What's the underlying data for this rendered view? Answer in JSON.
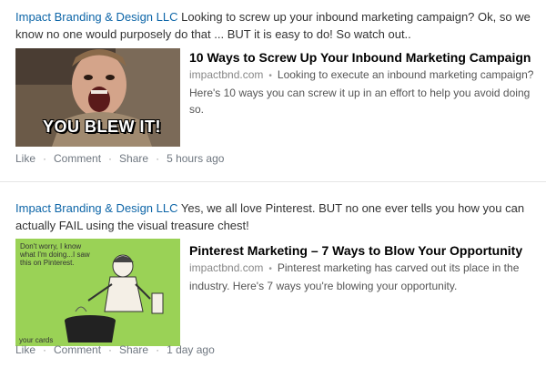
{
  "posts": [
    {
      "author": "Impact Branding & Design LLC",
      "text": " Looking to screw up your inbound marketing campaign? Ok, so we know no one would purposely do that ... BUT it is easy to do! So watch out..",
      "thumbnail_caption": "YOU BLEW IT!",
      "article_title": "10 Ways to Screw Up Your Inbound Marketing Campaign",
      "article_source": "impactbnd.com",
      "article_desc": "Looking to execute an inbound marketing campaign? Here's 10 ways you can screw it up in an effort to help you avoid doing so.",
      "like": "Like",
      "comment": "Comment",
      "share": "Share",
      "time": "5 hours ago"
    },
    {
      "author": "Impact Branding & Design LLC",
      "text": " Yes, we all love Pinterest. BUT no one ever tells you how you can actually FAIL using the visual treasure chest!",
      "thumbnail_caption": "Don't worry, I know what I'm doing...I saw this on Pinterest.",
      "thumbnail_brand": "your cards",
      "article_title": "Pinterest Marketing – 7 Ways to Blow Your Opportunity",
      "article_source": "impactbnd.com",
      "article_desc": "Pinterest marketing has carved out its place in the industry. Here's 7 ways you're blowing your opportunity.",
      "like": "Like",
      "comment": "Comment",
      "share": "Share",
      "time": "1 day ago"
    }
  ],
  "colors": {
    "author_link": "#0e66a8",
    "meta_text": "#6f7780",
    "ecard_bg": "#9ad256"
  }
}
